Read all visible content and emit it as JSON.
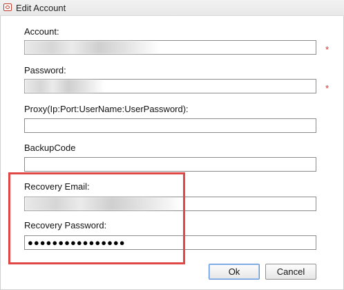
{
  "window": {
    "title": "Edit Account",
    "icon": "app-icon"
  },
  "fields": [
    {
      "label": "Account:",
      "value": "",
      "required": true,
      "required_mark": "*",
      "redacted": true
    },
    {
      "label": "Password:",
      "value": "",
      "required": true,
      "required_mark": "*",
      "redacted": true
    },
    {
      "label": "Proxy(Ip:Port:UserName:UserPassword):",
      "value": "",
      "required": false
    },
    {
      "label": "BackupCode",
      "value": "",
      "required": false
    },
    {
      "label": "Recovery Email:",
      "value": "",
      "required": false,
      "redacted": true
    },
    {
      "label": "Recovery Password:",
      "value": "●●●●●●●●●●●●●●●●",
      "required": false
    }
  ],
  "buttons": {
    "ok": "Ok",
    "cancel": "Cancel"
  },
  "colors": {
    "required_mark": "#d32f2f",
    "highlight_box": "#e04848"
  }
}
